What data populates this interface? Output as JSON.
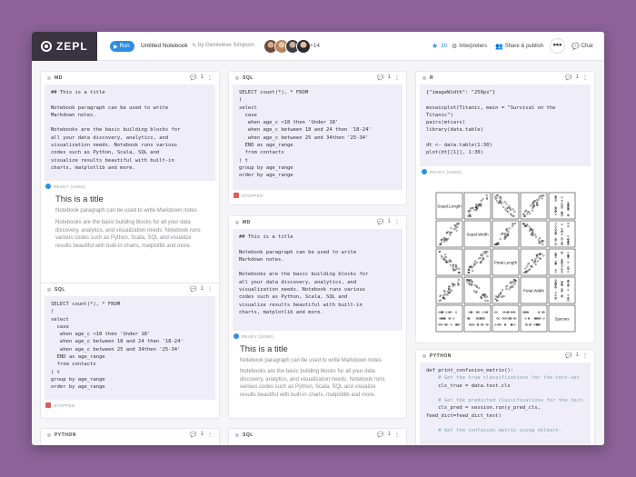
{
  "header": {
    "logo_text": "ZEPL",
    "run_label": "Run",
    "notebook_title": "Untitled Notebook",
    "byline": "by Genevieve Simpson",
    "more_collaborators": "+14",
    "star_count": "30",
    "interpreters_label": "Interpreters",
    "share_label": "Share & publish",
    "more_label": "•••",
    "chat_label": "Chat"
  },
  "colors": {
    "accent": "#2d8fe3",
    "logo_bg": "#3a3340",
    "background": "#8c6298",
    "code_bg": "#eeedf8"
  },
  "paragraphs": {
    "md1": {
      "lang": "MD",
      "comments": "1",
      "more": "⋮",
      "code": "## This is a title\n\nNotebook paragraph can be used to write\nMarkdown notes.\n\nNotebooks are the basic building blocks for\nall your data discovery, analytics, and\nvisualization needs. Notebook runs various\ncodes such as Python, Scala, SQL and\nvisualize results beautiful with built-in\ncharts, matplotlib and more.",
      "status": "READY (24MS)",
      "out_title": "This is a title",
      "out_line1": "Notebook paragraph can be used to write Markdown notes",
      "out_line2": "Notebooks are the basic building blocks for all your data discovery, analytics, and visualization needs. Notebook runs various codes such as Python, Scala, SQL and visualize results beautiful with built-in charts, matplotlib and more."
    },
    "sql1": {
      "lang": "SQL",
      "comments": "1",
      "more": "⋮",
      "code": "SELECT count(*), * FROM\n(\nselect\n  case\n   when age_c <18 then 'Under 18'\n   when age_c between 18 and 24 then '18-24'\n   when age_c between 25 and 34then '25-34'\n  END as age_range\n  from contacts\n) t\ngroup by age_range\norder by age_range",
      "status": "STOPPED"
    },
    "sql2": {
      "lang": "SQL",
      "comments": "1",
      "more": "⋮",
      "code": "SELECT count(*), * FROM\n(\nselect\n  case\n   when age_c <18 then 'Under 18'\n   when age_c between 18 and 24 then '18-24'\n   when age_c between 25 and 34then '25-34'\n  END as age_range\n  from contacts\n) t\ngroup by age_range\norder by age_range",
      "status": "STOPPED"
    },
    "md2": {
      "lang": "MD",
      "comments": "1",
      "more": "⋮",
      "code": "## This is a title\n\nNotebook paragraph can be used to write\nMarkdown notes.\n\nNotebooks are the basic building blocks for\nall your data discovery, analytics, and\nvisualization needs. Notebook runs various\ncodes such as Python, Scala, SQL and\nvisualize results beautiful with built-in\ncharts, matplotlib and more.",
      "status": "READY (24MS)",
      "out_title": "This is a title",
      "out_line1": "Notebook paragraph can be used to write Markdown notes",
      "out_line2": "Notebooks are the basic building blocks for all your data discovery, analytics, and visualization needs. Notebook runs various codes such as Python, Scala, SQL and visualize results beautiful with built-in charts, matplotlib and more."
    },
    "r1": {
      "lang": "R",
      "comments": "1",
      "more": "⋮",
      "code": "{\"imageWidth\": \"250px\"}\n\nmosaicplot(Titanic, main = \"Survival on the\nTitanic\")\npairs(mtcars)\nlibrary(data.table)\n\ndt <- data.table(1:30)\nplot(dt[[1]], 1:30)",
      "status": "READY (24MS)",
      "pairs_labels": [
        "Sepal.Length",
        "Sepal.Width",
        "Petal.Length",
        "Petal.Width",
        "Species"
      ]
    },
    "py1": {
      "lang": "PYTHON",
      "comments": "1",
      "more": "⋮",
      "code_lines": [
        {
          "t": "def print_confusion_matrix():",
          "c": false
        },
        {
          "t": "    # Get the true classifications for the test-set.",
          "c": true
        },
        {
          "t": "    cls_true = data.test.cls",
          "c": false
        },
        {
          "t": "",
          "c": false
        },
        {
          "t": "    # Get the predicted classifications for the test.",
          "c": true
        },
        {
          "t": "    cls_pred = session.run(y_pred_cls,",
          "c": false
        },
        {
          "t": "feed_dict=feed_dict_test)",
          "c": false
        },
        {
          "t": "",
          "c": false
        },
        {
          "t": "    # Get the confusion matrix using sklearn.",
          "c": true
        }
      ]
    },
    "py_bottom": {
      "lang": "PYTHON",
      "comments": "1",
      "more": "⋮"
    },
    "sql_bottom": {
      "lang": "SQL",
      "comments": "1",
      "more": "⋮"
    }
  }
}
